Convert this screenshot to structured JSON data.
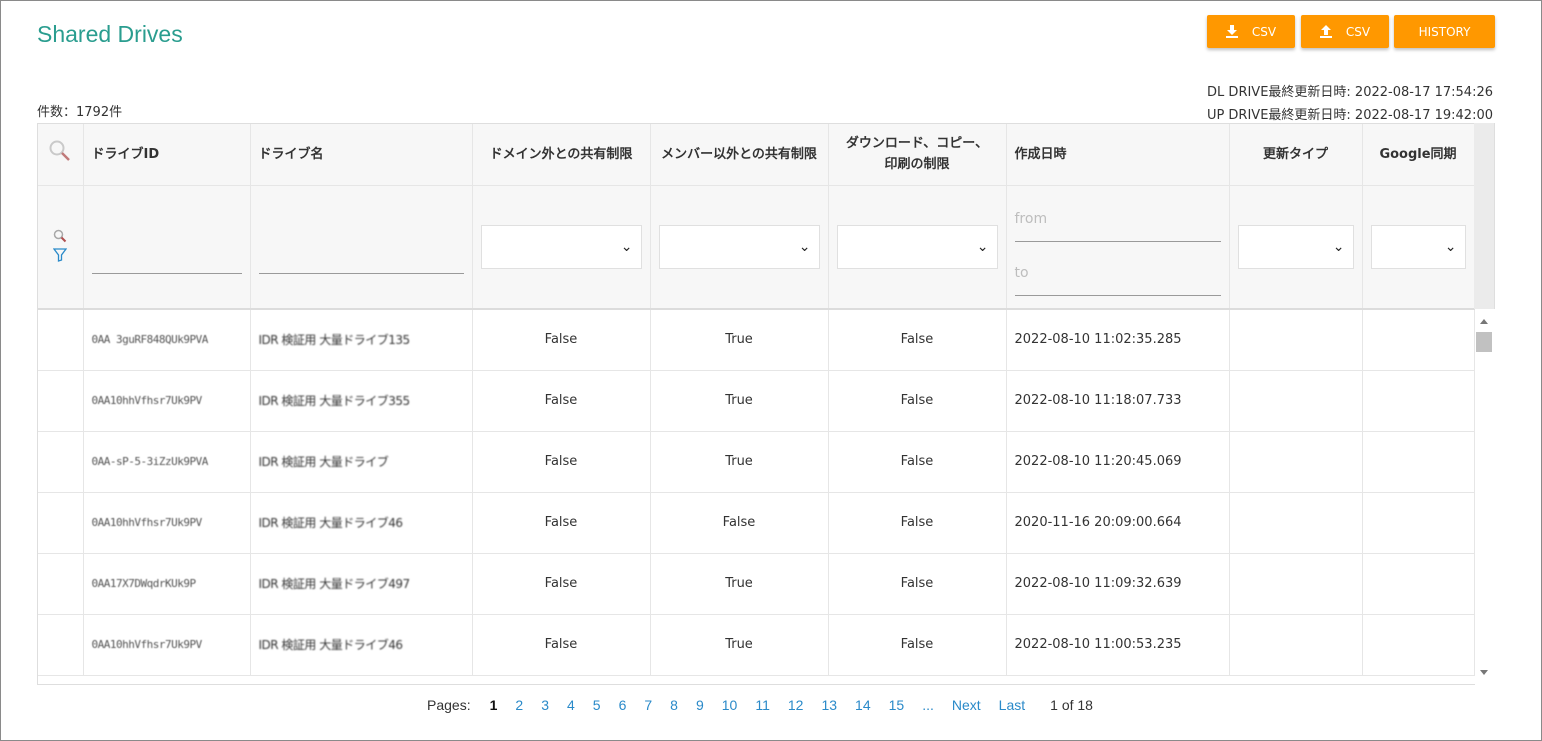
{
  "page": {
    "title": "Shared Drives",
    "count_label": "件数：1792件",
    "dl_updated": "DL DRIVE最終更新日時: 2022-08-17 17:54:26",
    "ul_updated": "UP DRIVE最終更新日時: 2022-08-17 19:42:00"
  },
  "toolbar": {
    "download_csv_label": "CSV",
    "upload_csv_label": "CSV",
    "history_label": "HISTORY",
    "accent_color": "#ff9800"
  },
  "table": {
    "columns": [
      "",
      "ドライブID",
      "ドライブ名",
      "ドメイン外との共有制限",
      "メンバー以外との共有制限",
      "ダウンロード、コピー、印刷の制限",
      "作成日時",
      "更新タイプ",
      "Google同期"
    ],
    "filters": {
      "date_from_placeholder": "from",
      "date_to_placeholder": "to"
    },
    "rows": [
      {
        "drive_id": "0AA 3guRF848QUk9PVA",
        "drive_name": "IDR 検証用 大量ドライブ135",
        "domain_restrict": "False",
        "member_restrict": "True",
        "download_restrict": "False",
        "created": "2022-08-10 11:02:35.285",
        "update_type": "",
        "google_sync": ""
      },
      {
        "drive_id": "0AA10hhVfhsr7Uk9PV",
        "drive_name": "IDR 検証用 大量ドライブ355",
        "domain_restrict": "False",
        "member_restrict": "True",
        "download_restrict": "False",
        "created": "2022-08-10 11:18:07.733",
        "update_type": "",
        "google_sync": ""
      },
      {
        "drive_id": "0AA-sP-5-3iZzUk9PVA",
        "drive_name": "IDR 検証用 大量ドライブ",
        "domain_restrict": "False",
        "member_restrict": "True",
        "download_restrict": "False",
        "created": "2022-08-10 11:20:45.069",
        "update_type": "",
        "google_sync": ""
      },
      {
        "drive_id": "0AA10hhVfhsr7Uk9PV",
        "drive_name": "IDR 検証用 大量ドライブ46",
        "domain_restrict": "False",
        "member_restrict": "False",
        "download_restrict": "False",
        "created": "2020-11-16 20:09:00.664",
        "update_type": "",
        "google_sync": ""
      },
      {
        "drive_id": "0AA17X7DWqdrKUk9P",
        "drive_name": "IDR 検証用 大量ドライブ497",
        "domain_restrict": "False",
        "member_restrict": "True",
        "download_restrict": "False",
        "created": "2022-08-10 11:09:32.639",
        "update_type": "",
        "google_sync": ""
      },
      {
        "drive_id": "0AA10hhVfhsr7Uk9PV",
        "drive_name": "IDR 検証用 大量ドライブ46",
        "domain_restrict": "False",
        "member_restrict": "True",
        "download_restrict": "False",
        "created": "2022-08-10 11:00:53.235",
        "update_type": "",
        "google_sync": ""
      }
    ]
  },
  "pager": {
    "label": "Pages:",
    "pages": [
      "1",
      "2",
      "3",
      "4",
      "5",
      "6",
      "7",
      "8",
      "9",
      "10",
      "11",
      "12",
      "13",
      "14",
      "15"
    ],
    "current": "1",
    "ellipsis": "...",
    "next": "Next",
    "last": "Last",
    "of_text": "1 of 18"
  }
}
